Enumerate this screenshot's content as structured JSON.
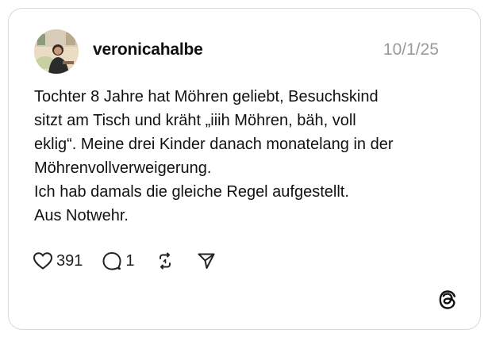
{
  "post": {
    "username": "veronicahalbe",
    "date": "10/1/25",
    "text_lines": [
      "Tochter 8 Jahre hat Möhren geliebt, Besuchskind",
      "sitzt am Tisch und kräht „iiih Möhren, bäh, voll",
      "eklig“. Meine drei Kinder danach monatelang in der",
      "Möhrenvollverweigerung.",
      "Ich hab damals die gleiche Regel aufgestellt.",
      "Aus Notwehr."
    ]
  },
  "actions": {
    "like_count": "391",
    "reply_count": "1"
  },
  "icons": {
    "like": "heart-icon",
    "reply": "reply-bubble-icon",
    "repost": "repost-icon",
    "share": "share-send-icon",
    "brand": "threads-logo-icon"
  },
  "colors": {
    "text": "#111111",
    "muted": "#9a9a9a",
    "border": "#d9d9d9"
  }
}
